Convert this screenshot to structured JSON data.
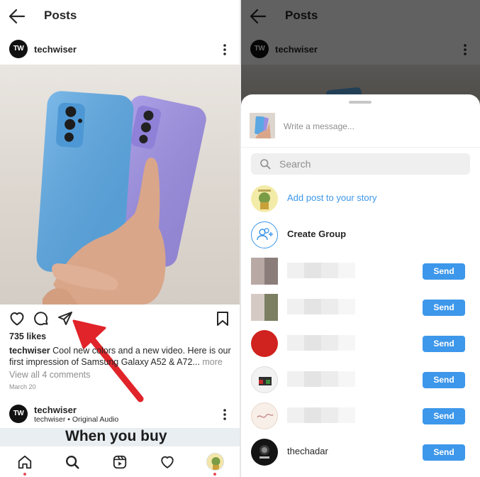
{
  "left": {
    "header": {
      "title": "Posts"
    },
    "post": {
      "username": "techwiser",
      "avatar_text": "TW",
      "likes": "735 likes",
      "caption_username": "techwiser",
      "caption_text": "Cool new colors and a new video. Here is our first impression of Samsung Galaxy A52 &  A72...",
      "caption_more": "more",
      "comments_link": "View all 4 comments",
      "date": "March 20"
    },
    "next_post": {
      "username": "techwiser",
      "avatar_text": "TW",
      "subtitle": "techwiser • Original Audio",
      "preview_text": "When you buy"
    },
    "bottom_nav": [
      "home",
      "search",
      "reels",
      "activity",
      "profile"
    ]
  },
  "right": {
    "header": {
      "title": "Posts"
    },
    "background_post": {
      "username": "techwiser",
      "avatar_text": "TW"
    },
    "share_sheet": {
      "message_placeholder": "Write a message...",
      "search_placeholder": "Search",
      "add_story_label": "Add post to your story",
      "create_group_label": "Create Group",
      "send_label": "Send",
      "recipients": [
        {
          "name": ""
        },
        {
          "name": ""
        },
        {
          "name": ""
        },
        {
          "name": ""
        },
        {
          "name": ""
        },
        {
          "name": "thechadar"
        }
      ]
    }
  },
  "colors": {
    "accent_blue": "#3d97ea",
    "link_blue": "#3d97ea",
    "arrow_red": "#e0242a",
    "notification_dot": "#ed4956"
  },
  "icons": [
    "back-arrow-icon",
    "more-vertical-icon",
    "heart-icon",
    "comment-icon",
    "send-paper-plane-icon",
    "bookmark-icon",
    "home-icon",
    "search-icon",
    "reels-icon",
    "heart-nav-icon",
    "create-group-icon"
  ]
}
